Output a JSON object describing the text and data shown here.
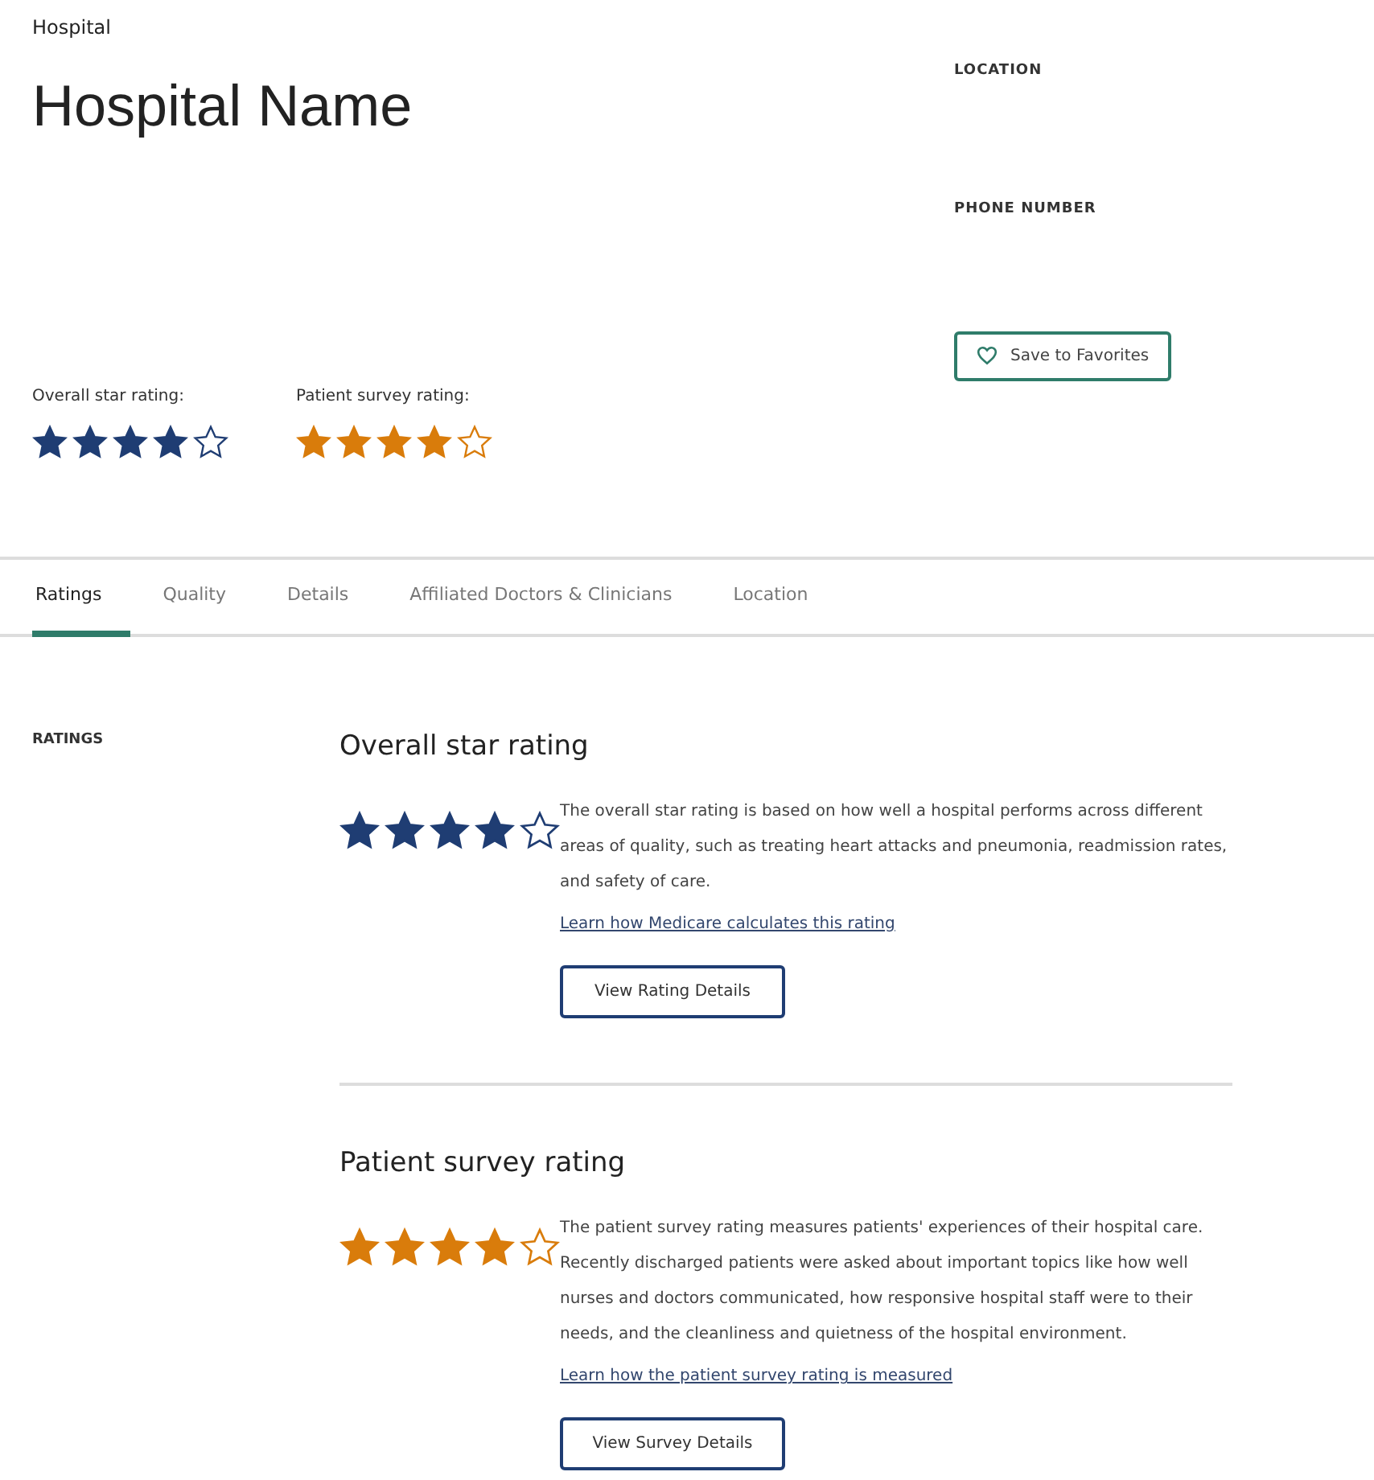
{
  "breadcrumb": "Hospital",
  "title": "Hospital Name",
  "contact": [
    {
      "label": "LOCATION"
    },
    {
      "label": "PHONE NUMBER"
    }
  ],
  "favorite_button": "Save to Favorites",
  "summary_ratings": [
    {
      "label": "Overall star rating:",
      "stars": 4,
      "color": "#1f3d73"
    },
    {
      "label": "Patient survey rating:",
      "stars": 4,
      "color": "#d97c0b"
    }
  ],
  "tabs": [
    {
      "label": "Ratings",
      "selected": true
    },
    {
      "label": "Quality",
      "selected": false
    },
    {
      "label": "Details",
      "selected": false
    },
    {
      "label": "Affiliated Doctors & Clinicians",
      "selected": false
    },
    {
      "label": "Location",
      "selected": false
    }
  ],
  "side_label": "RATINGS",
  "sections": [
    {
      "title": "Overall star rating",
      "stars": 4,
      "color": "#1f3d73",
      "description": "The overall star rating is based on how well a hospital performs across different areas of quality, such as treating heart attacks and pneumonia, readmission rates, and safety of care.",
      "link": "Learn how Medicare calculates this rating",
      "button": "View Rating Details"
    },
    {
      "title": "Patient survey rating",
      "stars": 4,
      "color": "#d97c0b",
      "description": "The patient survey rating measures patients' experiences of their hospital care. Recently discharged patients were asked about important topics like how well nurses and doctors communicated, how responsive hospital staff were to their needs, and the cleanliness and quietness of the hospital environment.",
      "link": "Learn how the patient survey rating is measured",
      "button": "View Survey Details"
    }
  ]
}
